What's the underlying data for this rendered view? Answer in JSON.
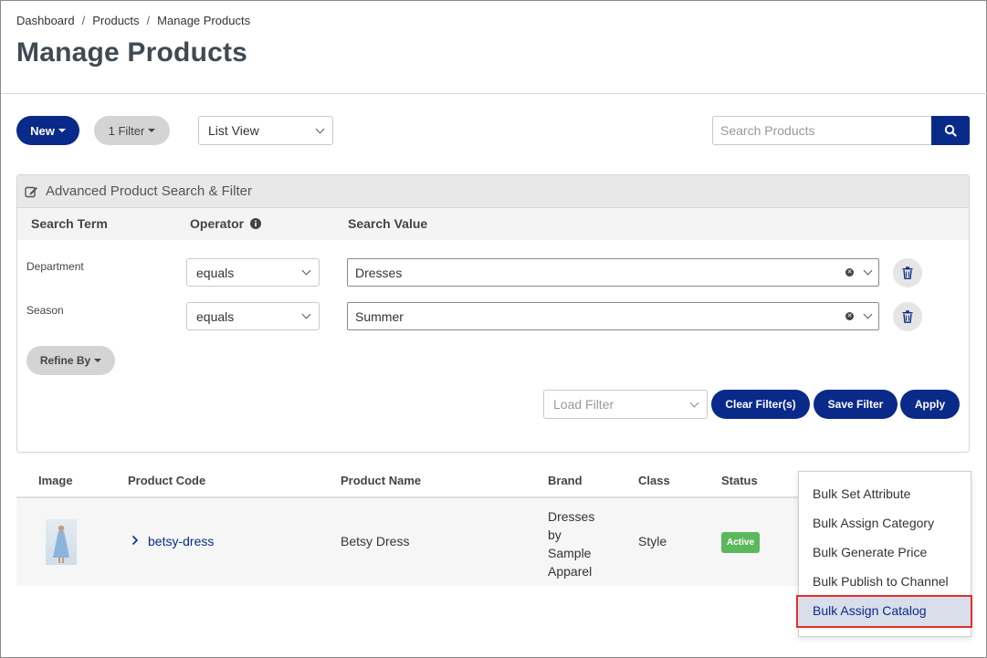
{
  "breadcrumb": {
    "items": [
      "Dashboard",
      "Products",
      "Manage Products"
    ],
    "separator": "/"
  },
  "page_title": "Manage Products",
  "toolbar": {
    "new_label": "New",
    "filter_label": "1 Filter",
    "view_select_value": "List View",
    "search_placeholder": "Search Products"
  },
  "panel": {
    "title": "Advanced Product Search & Filter",
    "columns": {
      "term": "Search Term",
      "operator": "Operator",
      "value": "Search Value"
    },
    "rows": [
      {
        "term": "Department",
        "operator": "equals",
        "value": "Dresses"
      },
      {
        "term": "Season",
        "operator": "equals",
        "value": "Summer"
      }
    ],
    "refine_label": "Refine By",
    "load_filter_placeholder": "Load Filter",
    "clear_label": "Clear Filter(s)",
    "save_label": "Save Filter",
    "apply_label": "Apply"
  },
  "table": {
    "headers": {
      "image": "Image",
      "code": "Product Code",
      "name": "Product Name",
      "brand": "Brand",
      "class": "Class",
      "status": "Status"
    },
    "rows": [
      {
        "code": "betsy-dress",
        "name": "Betsy Dress",
        "brand_lines": [
          "Dresses",
          "by",
          "Sample",
          "Apparel"
        ],
        "class": "Style",
        "status": "Active"
      }
    ]
  },
  "bulk_menu": {
    "items": [
      "Bulk Set Attribute",
      "Bulk Assign Category",
      "Bulk Generate Price",
      "Bulk Publish to Channel",
      "Bulk Assign Catalog"
    ],
    "highlighted": "Bulk Assign Catalog"
  },
  "colors": {
    "primary": "#0a2a8a",
    "active_badge": "#5cb85c",
    "highlight_border": "#e2302c"
  }
}
